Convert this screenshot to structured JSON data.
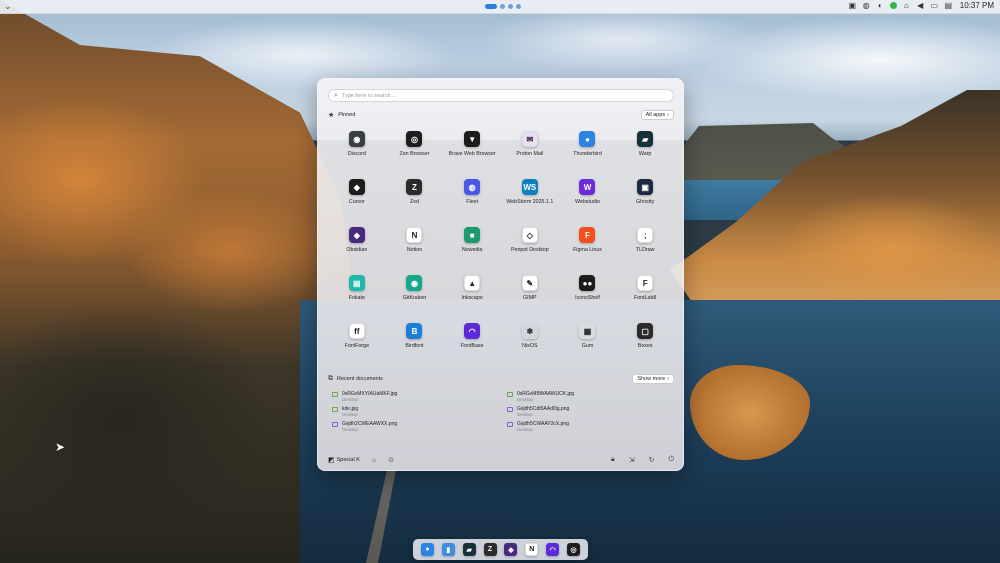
{
  "topbar": {
    "clock": "10:37 PM",
    "tray_icons": [
      "display-icon",
      "compass-icon",
      "palette-icon",
      "status-green-icon",
      "network-icon",
      "volume-icon",
      "battery-icon",
      "keyboard-icon"
    ]
  },
  "launcher": {
    "search_placeholder": "Type here to search ...",
    "pinned_label": "Pinned",
    "all_apps_label": "All apps",
    "apps": [
      {
        "label": "Discord",
        "glyph": "◉",
        "color": "#3b3d45"
      },
      {
        "label": "Zen Browser",
        "glyph": "◎",
        "color": "#1e1e1e"
      },
      {
        "label": "Brave Web Browser",
        "glyph": "▼",
        "color": "#1c1c1c"
      },
      {
        "label": "Proton Mail",
        "glyph": "✉",
        "color": "#e9ddf8"
      },
      {
        "label": "Thunderbird",
        "glyph": "●",
        "color": "#2d82e5"
      },
      {
        "label": "Warp",
        "glyph": "▰",
        "color": "#16313a"
      },
      {
        "label": "Cursor",
        "glyph": "◆",
        "color": "#1c1c1c"
      },
      {
        "label": "Zed",
        "glyph": "Z",
        "color": "#2b2b2b"
      },
      {
        "label": "Fleet",
        "glyph": "◍",
        "color": "#4a58e8"
      },
      {
        "label": "WebStorm 2025.1.1",
        "glyph": "WS",
        "color": "#0f7fbf"
      },
      {
        "label": "Webstudio",
        "glyph": "W",
        "color": "#6b2bd8"
      },
      {
        "label": "Ghostty",
        "glyph": "▣",
        "color": "#1c2a44"
      },
      {
        "label": "Obsidian",
        "glyph": "◆",
        "color": "#4b2a7e"
      },
      {
        "label": "Notion",
        "glyph": "N",
        "color": "#ffffff"
      },
      {
        "label": "Nowedia",
        "glyph": "■",
        "color": "#1f9a6e"
      },
      {
        "label": "Penpot Desktop",
        "glyph": "◇",
        "color": "#ffffff"
      },
      {
        "label": "Figma Linux",
        "glyph": "F",
        "color": "#f24e1e"
      },
      {
        "label": "TLDraw",
        "glyph": ";",
        "color": "#ffffff"
      },
      {
        "label": "Fokate",
        "glyph": "▤",
        "color": "#1fb9a9"
      },
      {
        "label": "GitKraken",
        "glyph": "◉",
        "color": "#14a88d"
      },
      {
        "label": "Inkscape",
        "glyph": "▲",
        "color": "#ffffff"
      },
      {
        "label": "GIMP",
        "glyph": "✎",
        "color": "#ffffff"
      },
      {
        "label": "IconsShelf",
        "glyph": "●●",
        "color": "#1c1c1c"
      },
      {
        "label": "FontLab8",
        "glyph": "F",
        "color": "#ffffff"
      },
      {
        "label": "FontForge",
        "glyph": "ff",
        "color": "#ffffff"
      },
      {
        "label": "Birdfont",
        "glyph": "B",
        "color": "#1e7fd8"
      },
      {
        "label": "FontBase",
        "glyph": "◠",
        "color": "#5b2bd8"
      },
      {
        "label": "NixOS",
        "glyph": "❄",
        "color": "#cfd4dd"
      },
      {
        "label": "Gum",
        "glyph": "▦",
        "color": "#d8dde4"
      },
      {
        "label": "Boxes",
        "glyph": "▢",
        "color": "#2a2a2a"
      }
    ],
    "recent_label": "Recent documents",
    "show_more_label": "Show more",
    "documents": [
      {
        "name": "0xRGvMXYIAUaMKF.jpg",
        "location": "Desktop",
        "color": "green"
      },
      {
        "name": "0xRGvMBWAAWUCK.jpg",
        "location": "Desktop",
        "color": "green"
      },
      {
        "name": "kde.jpg",
        "location": "Desktop",
        "color": "green"
      },
      {
        "name": "Gsjdh5Cdt5AAdl3g.png",
        "location": "Desktop",
        "color": "purple"
      },
      {
        "name": "Gsjdh2CWEAAWXX.png",
        "location": "Desktop",
        "color": "purple"
      },
      {
        "name": "Gsjdh5CWAAY2cX.png",
        "location": "Desktop",
        "color": "purple"
      }
    ],
    "user_name": "Special K"
  },
  "dock": {
    "apps": [
      {
        "name": "Thunderbird",
        "glyph": "●",
        "color": "#2d82e5"
      },
      {
        "name": "Files",
        "glyph": "▮",
        "color": "#3c8de0"
      },
      {
        "name": "Warp",
        "glyph": "▰",
        "color": "#16313a"
      },
      {
        "name": "Zed",
        "glyph": "Z",
        "color": "#2b2b2b"
      },
      {
        "name": "Obsidian",
        "glyph": "◆",
        "color": "#4b2a7e"
      },
      {
        "name": "Notion",
        "glyph": "N",
        "color": "#ffffff"
      },
      {
        "name": "FontBase",
        "glyph": "◠",
        "color": "#5b2bd8"
      },
      {
        "name": "Zen Browser",
        "glyph": "◎",
        "color": "#1e1e1e"
      }
    ]
  }
}
